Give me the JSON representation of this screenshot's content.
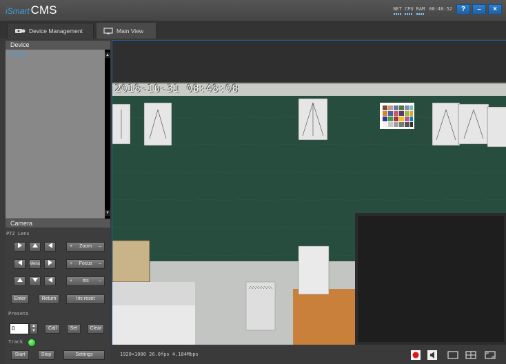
{
  "app": {
    "brand": "iSmart",
    "title": "CMS"
  },
  "sysinfo": {
    "net": "NET",
    "cpu": "CPU",
    "ram": "RAM",
    "clock": "08:48:52"
  },
  "window_buttons": {
    "help": "?",
    "minimize": "–",
    "close": "×"
  },
  "tabs": [
    {
      "label": "Device Management",
      "icon": "device-management-icon"
    },
    {
      "label": "Main View",
      "icon": "main-view-icon"
    }
  ],
  "device": {
    "heading": "Device",
    "tree_item": "DVS"
  },
  "camera": {
    "heading": "Camera",
    "ptz_label": "PTZ Lens",
    "zoom": "Zoom",
    "focus": "Focus",
    "iris": "Iris",
    "menu": "Menu",
    "enter": "Enter",
    "return": "Return",
    "iris_reset": "Iris reset",
    "presets_label": "Presets",
    "preset_value": "0",
    "call": "Call",
    "set": "Set",
    "clear": "Clear",
    "track_label": "Track",
    "start": "Start",
    "stop": "Stop",
    "settings": "Settings"
  },
  "video": {
    "timestamp": "2018-10-31 08:48:08",
    "stream_info": "1920×1080 26.0fps 4.184Mbps"
  },
  "colors": {
    "accent": "#1f5fa3",
    "record": "#d9181c",
    "track_led": "#2ecc2e"
  }
}
